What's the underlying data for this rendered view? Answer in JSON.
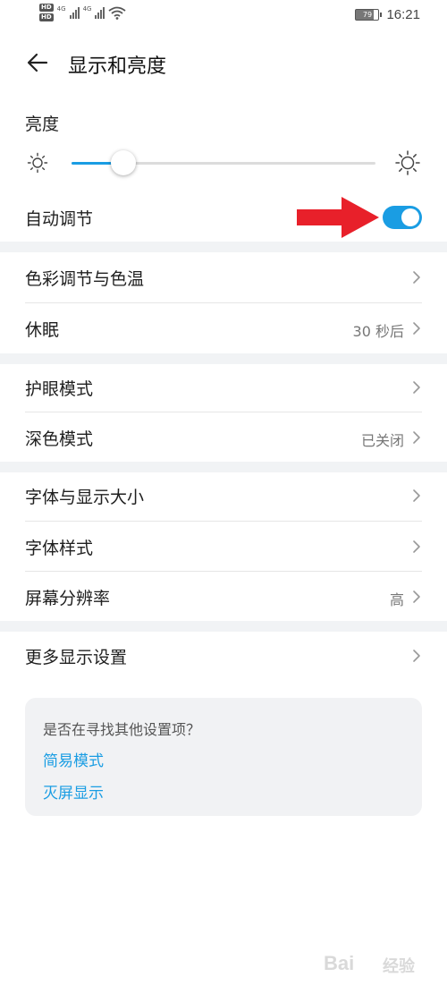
{
  "status_bar": {
    "hd_top": "HD",
    "hd_bottom": "HD",
    "net1": "4G",
    "net2": "4G",
    "battery": "79",
    "time": "16:21"
  },
  "header": {
    "title": "显示和亮度"
  },
  "brightness": {
    "label": "亮度",
    "level": 0.17
  },
  "auto_adjust": {
    "label": "自动调节",
    "enabled": true
  },
  "colors": {
    "accent": "#1a9de3",
    "arrow": "#e8202a",
    "separator": "#f1f3f5"
  },
  "rows": [
    {
      "label": "色彩调节与色温",
      "value": ""
    },
    {
      "label": "休眠",
      "value": "30 秒后"
    },
    {
      "label": "护眼模式",
      "value": ""
    },
    {
      "label": "深色模式",
      "value": "已关闭"
    },
    {
      "label": "字体与显示大小",
      "value": ""
    },
    {
      "label": "字体样式",
      "value": ""
    },
    {
      "label": "屏幕分辨率",
      "value": "高"
    },
    {
      "label": "更多显示设置",
      "value": ""
    }
  ],
  "suggestion": {
    "question": "是否在寻找其他设置项？",
    "links": [
      "简易模式",
      "灭屏显示"
    ]
  },
  "watermark": {
    "text": "Bai",
    "text2": "经验"
  },
  "icons": [
    "back-arrow-icon",
    "sun-small-icon",
    "sun-large-icon",
    "chevron-right-icon",
    "wifi-icon",
    "battery-icon",
    "signal-icon"
  ]
}
